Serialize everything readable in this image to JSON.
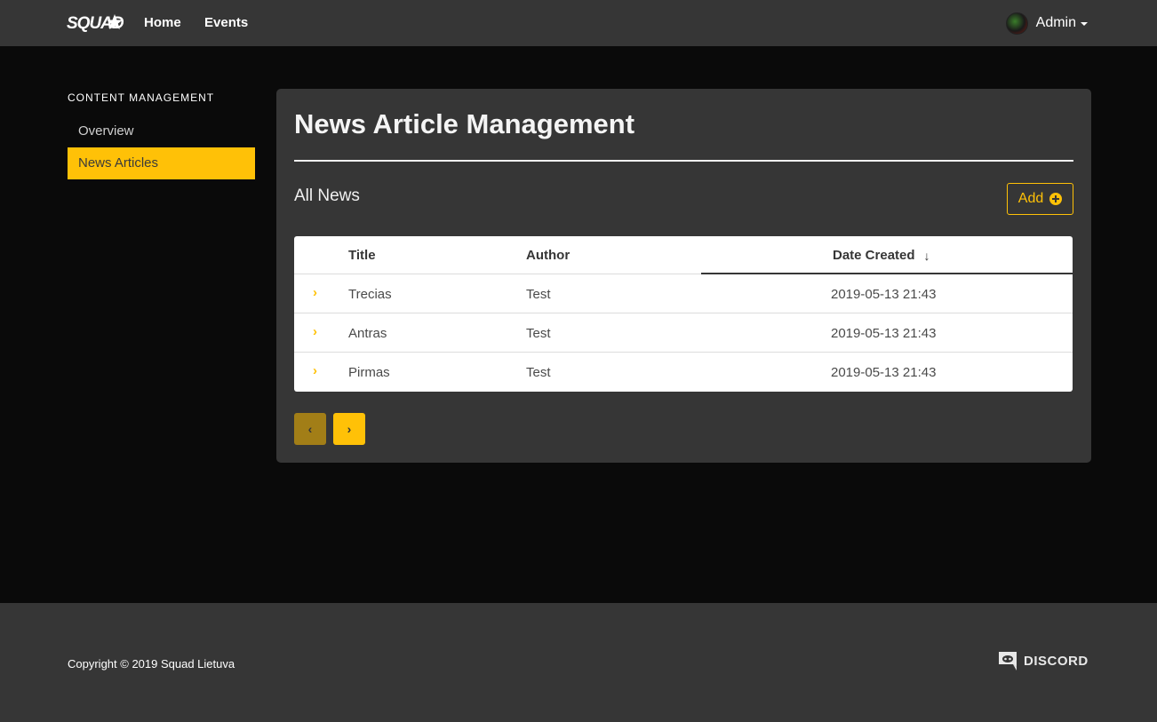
{
  "navbar": {
    "logo_text": "SQUAD",
    "links": [
      {
        "label": "Home"
      },
      {
        "label": "Events"
      }
    ],
    "user": {
      "label": "Admin"
    }
  },
  "sidebar": {
    "heading": "CONTENT MANAGEMENT",
    "items": [
      {
        "label": "Overview",
        "active": false
      },
      {
        "label": "News Articles",
        "active": true
      }
    ]
  },
  "main": {
    "title": "News Article Management",
    "section_title": "All News",
    "add_label": "Add",
    "table": {
      "columns": [
        "Title",
        "Author",
        "Date Created"
      ],
      "sort_column": "Date Created",
      "sort_direction": "desc",
      "rows": [
        {
          "title": "Trecias",
          "author": "Test",
          "date": "2019-05-13 21:43"
        },
        {
          "title": "Antras",
          "author": "Test",
          "date": "2019-05-13 21:43"
        },
        {
          "title": "Pirmas",
          "author": "Test",
          "date": "2019-05-13 21:43"
        }
      ]
    }
  },
  "footer": {
    "copyright": "Copyright © 2019 Squad Lietuva",
    "discord_label": "DISCORD"
  },
  "colors": {
    "accent": "#ffc107",
    "navbar_bg": "#363636",
    "page_bg": "#0a0a0a",
    "panel_bg": "#363636"
  },
  "icons": {
    "expand": "chevron-right-icon",
    "sort": "arrow-down-icon",
    "add": "plus-circle-icon",
    "prev": "chevron-left-icon",
    "next": "chevron-right-icon"
  }
}
